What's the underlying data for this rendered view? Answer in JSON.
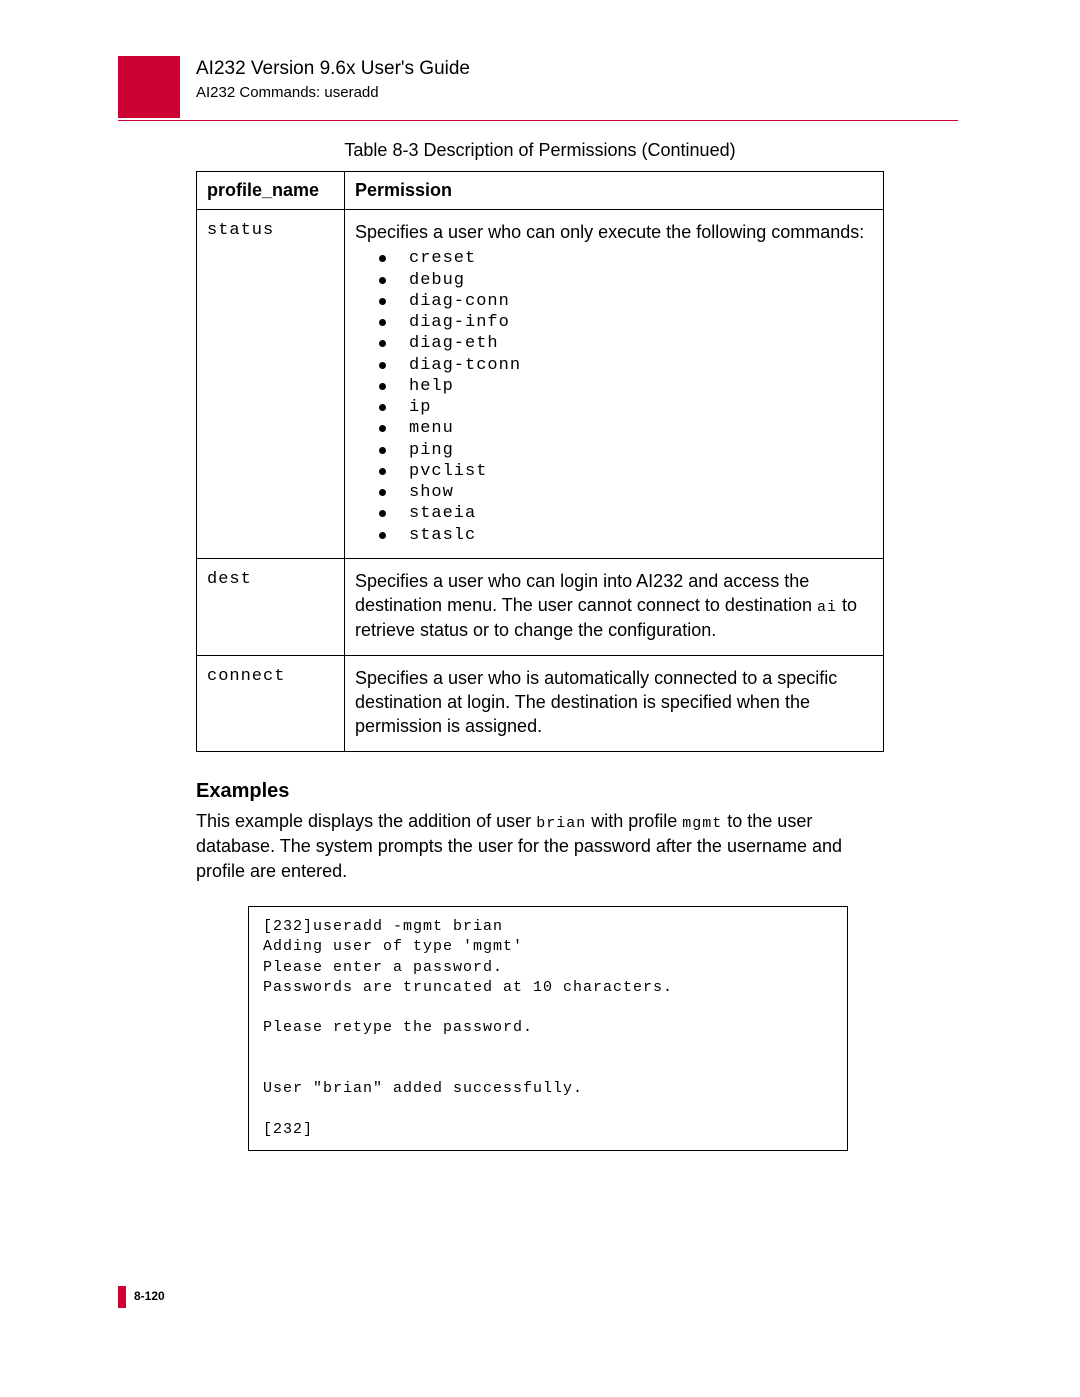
{
  "header": {
    "title": "AI232 Version 9.6x User's Guide",
    "subtitle": "AI232 Commands: useradd"
  },
  "table": {
    "caption": "Table 8-3   Description of Permissions (Continued)",
    "col1": "profile_name",
    "col2": "Permission",
    "rows": {
      "status": {
        "name": "status",
        "intro": "Specifies a user who can only execute the following commands:",
        "cmds": [
          "creset",
          "debug",
          "diag-conn",
          "diag-info",
          "diag-eth",
          "diag-tconn",
          "help",
          "ip",
          "menu",
          "ping",
          "pvclist",
          "show",
          "staeia",
          "staslc"
        ]
      },
      "dest": {
        "name": "dest",
        "text_a": "Specifies a user who can login into AI232 and access the destination menu. The user cannot connect to destination ",
        "text_mono": "ai",
        "text_b": " to retrieve status or to change the configuration."
      },
      "connect": {
        "name": "connect",
        "text": "Specifies a user who is automatically connected to a specific destination at login. The destination is specified when the permission is assigned."
      }
    }
  },
  "examples": {
    "heading": "Examples",
    "text_a": "This example displays the addition of user ",
    "text_mono1": "brian",
    "text_b": " with profile ",
    "text_mono2": "mgmt",
    "text_c": " to the user database. The system prompts the user for the password after the username and profile are entered."
  },
  "code": "[232]useradd -mgmt brian\nAdding user of type 'mgmt'\nPlease enter a password.\nPasswords are truncated at 10 characters.\n\nPlease retype the password.\n\n\nUser \"brian\" added successfully.\n\n[232]",
  "footer": {
    "page": "8-120"
  }
}
